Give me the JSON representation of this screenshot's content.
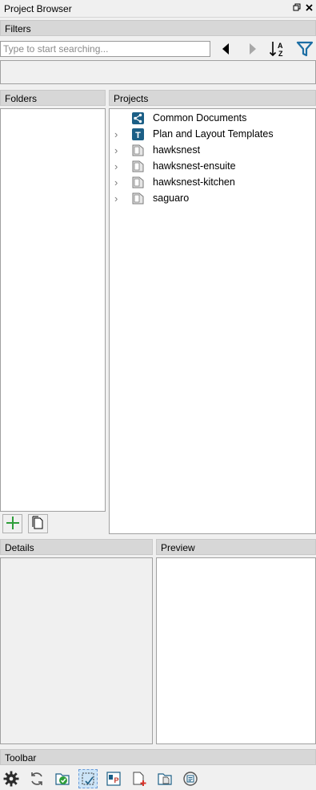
{
  "window": {
    "title": "Project Browser"
  },
  "filters": {
    "header": "Filters",
    "search_placeholder": "Type to start searching...",
    "search_value": ""
  },
  "folders": {
    "header": "Folders"
  },
  "projects": {
    "header": "Projects",
    "items": [
      {
        "label": "Common Documents",
        "icon": "share-icon",
        "expandable": false
      },
      {
        "label": "Plan and Layout Templates",
        "icon": "template-icon",
        "expandable": true
      },
      {
        "label": "hawksnest",
        "icon": "project-icon",
        "expandable": true
      },
      {
        "label": "hawksnest-ensuite",
        "icon": "project-icon",
        "expandable": true
      },
      {
        "label": "hawksnest-kitchen",
        "icon": "project-icon",
        "expandable": true
      },
      {
        "label": "saguaro",
        "icon": "project-icon",
        "expandable": true
      }
    ]
  },
  "details": {
    "header": "Details"
  },
  "preview": {
    "header": "Preview"
  },
  "toolbar": {
    "header": "Toolbar",
    "tools": [
      "settings-gear-icon",
      "refresh-icon",
      "check-folder-icon",
      "select-area-icon",
      "properties-icon",
      "add-document-icon",
      "copy-document-icon",
      "history-icon"
    ]
  },
  "colors": {
    "accent_blue": "#1c6ea4",
    "add_green": "#2e9e3a",
    "header_grey": "#d7d7d7"
  }
}
